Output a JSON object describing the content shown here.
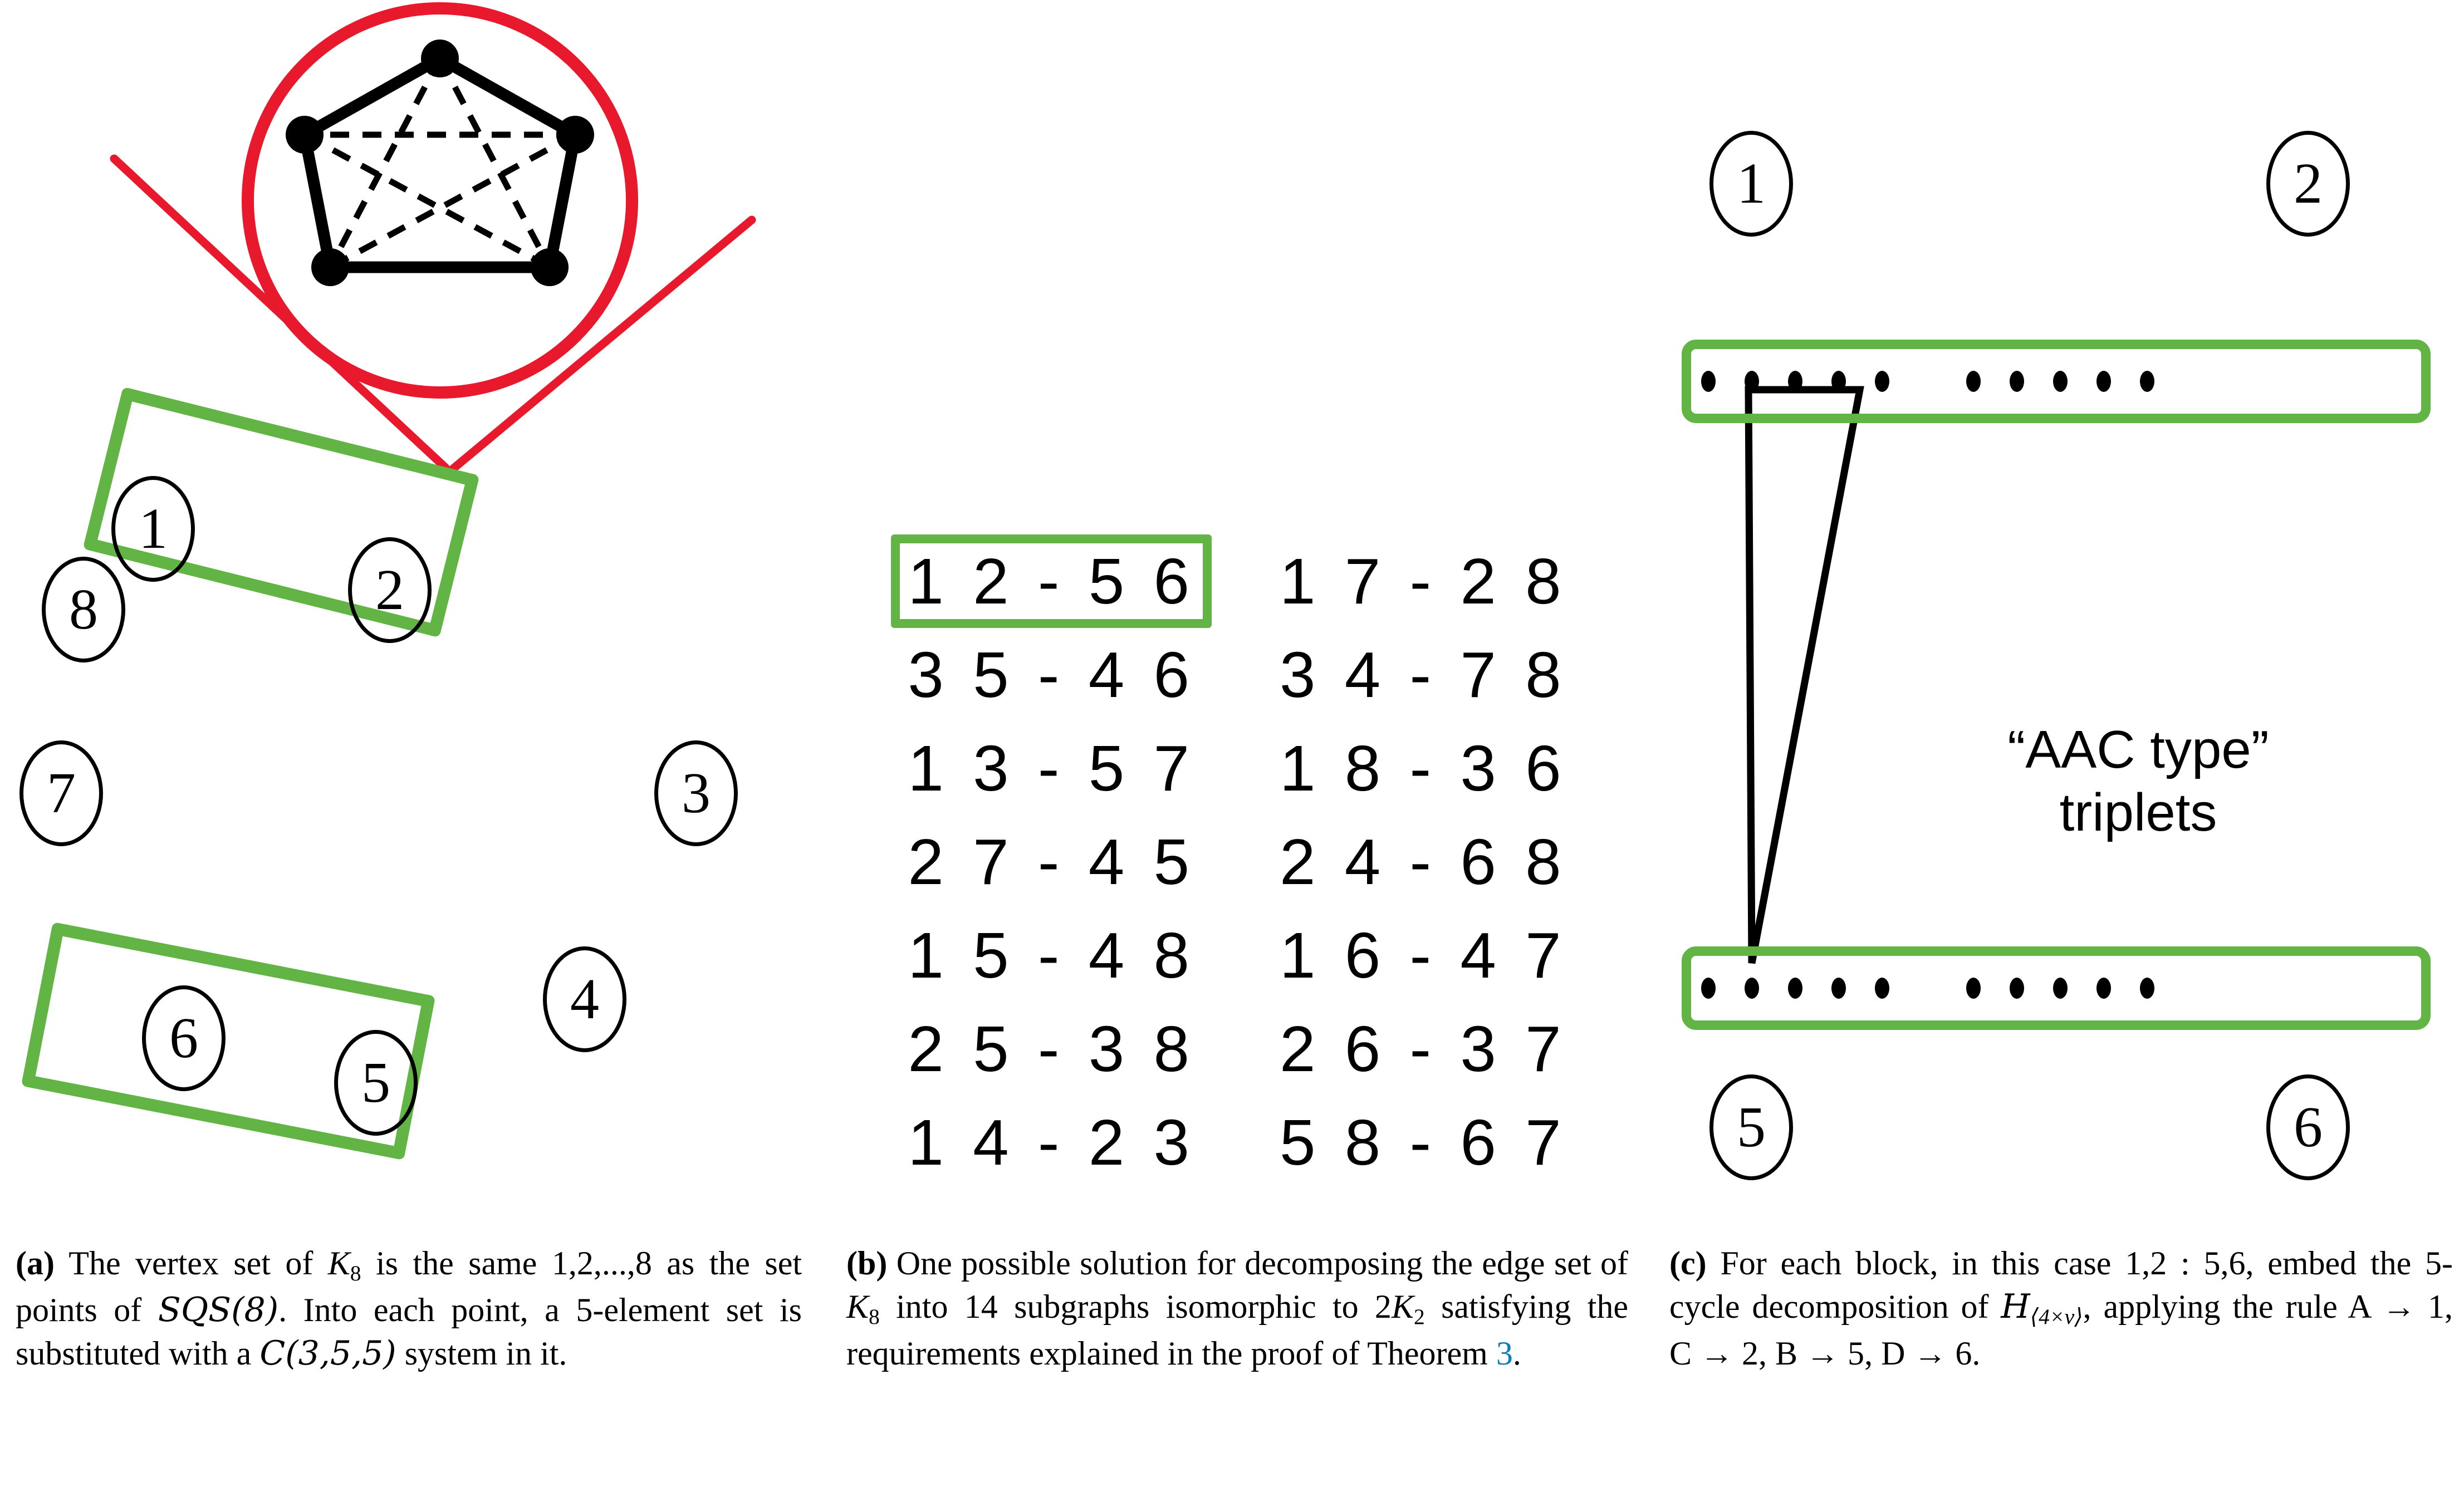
{
  "figure": {
    "panel_a": {
      "vertices": [
        "1",
        "2",
        "8",
        "7",
        "3",
        "6",
        "5",
        "4"
      ],
      "blocks": [
        {
          "name": "block-1-2",
          "members": [
            "1",
            "2"
          ]
        },
        {
          "name": "block-6-5",
          "members": [
            "6",
            "5"
          ]
        }
      ],
      "magnifier": {
        "shape": "pentagon",
        "solid_edges": 5,
        "dashed_edges": 5,
        "vertex_count": 5,
        "circle_color": "#e8192c"
      },
      "highlight_color": "#62b544"
    },
    "panel_b": {
      "left_column": [
        {
          "pair": "1 2 - 5 6",
          "boxed": true
        },
        {
          "pair": "3 5 - 4 6",
          "boxed": false
        },
        {
          "pair": "1 3 - 5 7",
          "boxed": false
        },
        {
          "pair": "2 7 - 4 5",
          "boxed": false
        },
        {
          "pair": "1 5 - 4 8",
          "boxed": false
        },
        {
          "pair": "2 5 - 3 8",
          "boxed": false
        },
        {
          "pair": "1 4 - 2 3",
          "boxed": false
        }
      ],
      "right_column": [
        {
          "pair": "1 7 - 2 8",
          "boxed": false
        },
        {
          "pair": "3 4 - 7 8",
          "boxed": false
        },
        {
          "pair": "1 8 - 3 6",
          "boxed": false
        },
        {
          "pair": "2 4 - 6 8",
          "boxed": false
        },
        {
          "pair": "1 6 - 4 7",
          "boxed": false
        },
        {
          "pair": "2 6 - 3 7",
          "boxed": false
        },
        {
          "pair": "5 8 - 6 7",
          "boxed": false
        }
      ],
      "highlight_color": "#62b544"
    },
    "panel_c": {
      "top_labels": [
        "1",
        "2"
      ],
      "bottom_labels": [
        "5",
        "6"
      ],
      "top_row_dots": 10,
      "bottom_row_dots": 10,
      "dot_groups": [
        5,
        5
      ],
      "annotation": "“AAC type”\ntriplets",
      "highlight_color": "#62b544"
    }
  },
  "captions": {
    "a": {
      "label": "(a)",
      "t1": " The vertex set of ",
      "k": "K",
      "ksub": "8",
      "t2": " is the same 1,2,...,8 as the set points of ",
      "sqs": "SQS(8)",
      "t3": ". Into each point, a 5-element set is substituted with a ",
      "c355": "C(3,5,5)",
      "t4": " system in it."
    },
    "b": {
      "label": "(b)",
      "t1": " One possible solution for decomposing the edge set of ",
      "k": "K",
      "ksub": "8",
      "t2": " into 14 subgraphs isomorphic to 2",
      "k2": "K",
      "k2sub": "2",
      "t3": " satisfying the requirements explained in the proof of Theorem ",
      "ref": "3",
      "t4": "."
    },
    "c": {
      "label": "(c)",
      "t1": " For each block, in this case  1,2 : 5,6,  embed the 5-cycle decomposition of ",
      "h": "H",
      "hsub": "⟨4×v⟩",
      "t2": ", applying the rule  ",
      "r1": "A → 1",
      "sep1": ",   ",
      "r2": "C → 2",
      "sep2": ",   ",
      "r3": "B → 5",
      "sep3": ",   ",
      "r4": "D → 6",
      "t3": "."
    }
  },
  "colors": {
    "green": "#62b544",
    "red": "#e8192c",
    "blue": "#0b7dba",
    "black": "#000000"
  }
}
